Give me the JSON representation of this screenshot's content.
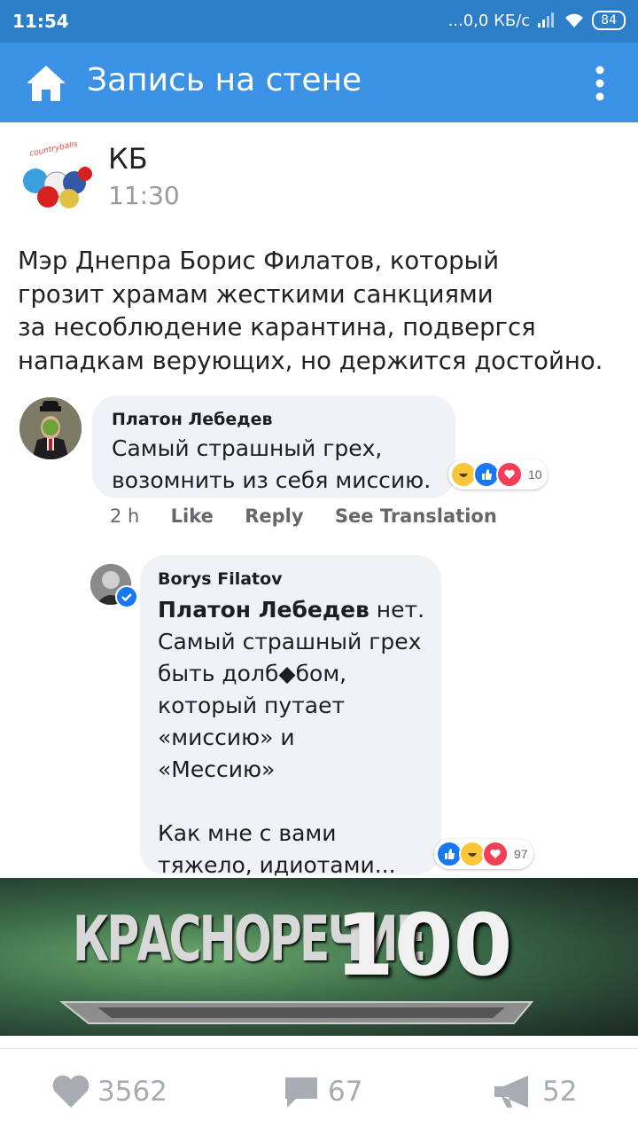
{
  "status_bar": {
    "time": "11:54",
    "network": "...0,0 КБ/с",
    "battery": "84"
  },
  "toolbar": {
    "title": "Запись на стене"
  },
  "post": {
    "author": "КБ",
    "time": "11:30",
    "avatar_label": "countryballs",
    "text_lines": [
      "Мэр Днепра Борис Филатов, который",
      "грозит храмам жесткими санкциями",
      "за несоблюдение карантина, подвергся",
      "нападкам верующих, но держится достойно."
    ]
  },
  "comment1": {
    "name": "Платон Лебедев",
    "lines": [
      "Самый страшный грех,",
      "возомнить из себя миссию."
    ],
    "reactions": "10",
    "time": "2 h",
    "like": "Like",
    "reply": "Reply",
    "translate": "See Translation"
  },
  "comment2": {
    "name": "Borys Filatov",
    "mention": "Платон Лебедев",
    "line1_rest": " нет.",
    "lines": [
      "Самый страшный грех",
      "быть долб◆бом,",
      "который путает",
      "«миссию» и",
      "«Мессию»",
      "",
      "Как мне с вами",
      "тяжело, идиотами..."
    ],
    "reactions": "97"
  },
  "banner": {
    "word": "КРАСНОРЕЧИЕ",
    "number": "100"
  },
  "footer": {
    "likes": "3562",
    "comments": "67",
    "reposts": "52"
  },
  "colors": {
    "status_bar": "#2d7ec8",
    "toolbar": "#3b92e4",
    "icon_gray": "#a7acb3"
  }
}
